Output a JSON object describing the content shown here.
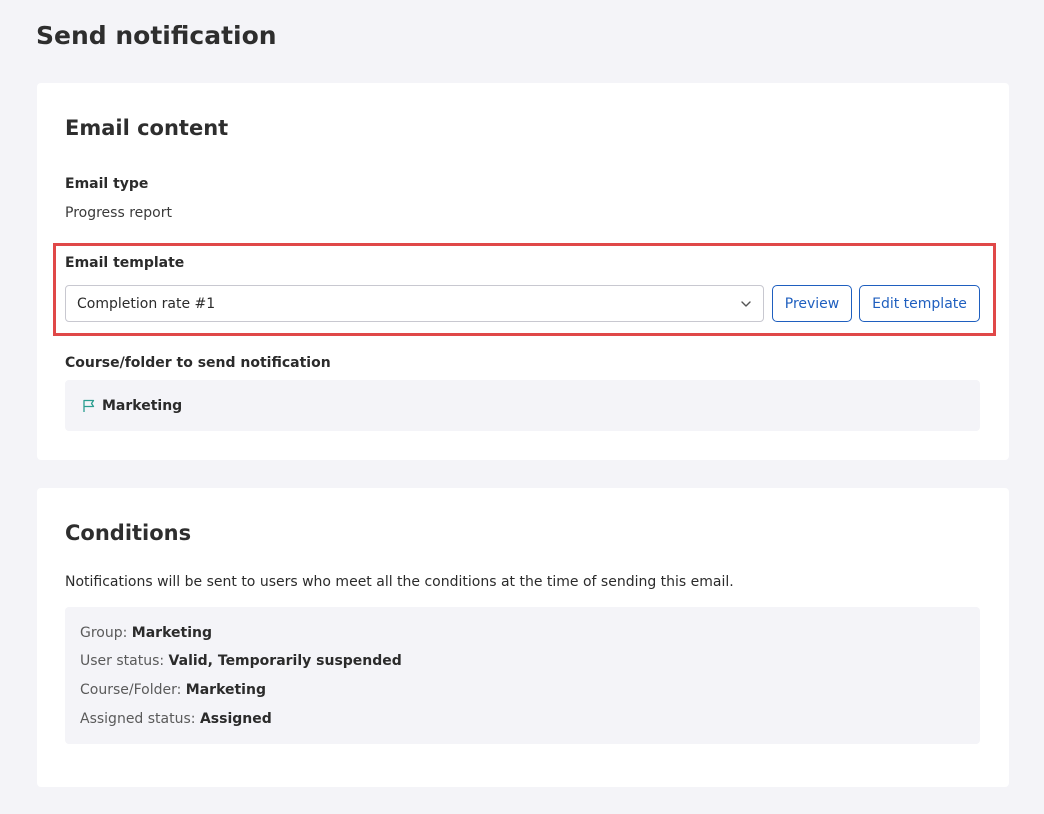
{
  "page": {
    "title": "Send notification"
  },
  "email_content": {
    "title": "Email content",
    "email_type_label": "Email type",
    "email_type_value": "Progress report",
    "email_template_label": "Email template",
    "email_template_selected": "Completion rate #1",
    "preview_button": "Preview",
    "edit_template_button": "Edit template",
    "course_label": "Course/folder to send notification",
    "course_name": "Marketing",
    "highlight_color": "#e04848"
  },
  "conditions": {
    "title": "Conditions",
    "description": "Notifications will be sent to users who meet all the conditions at the time of sending this email.",
    "rows": [
      {
        "key": "Group: ",
        "value": "Marketing"
      },
      {
        "key": "User status: ",
        "value": "Valid, Temporarily suspended"
      },
      {
        "key": "Course/Folder: ",
        "value": "Marketing"
      },
      {
        "key": "Assigned status: ",
        "value": "Assigned"
      }
    ]
  },
  "icons": {
    "select_arrow": "chevron-down-icon",
    "course": "flag-icon"
  },
  "colors": {
    "accent": "#1f5fbf",
    "flag": "#2a9d8f",
    "background": "#f4f4f8"
  }
}
